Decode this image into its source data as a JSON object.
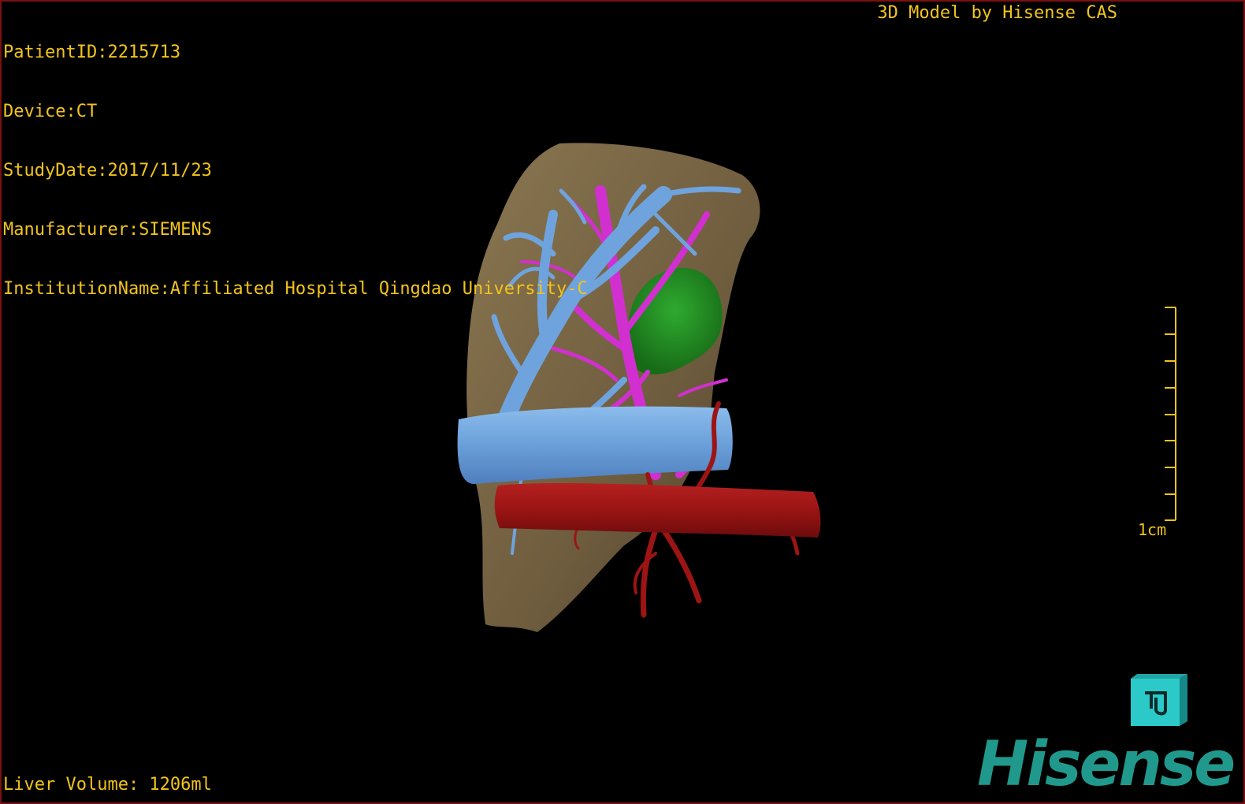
{
  "header": {
    "patient_id": "PatientID:2215713",
    "device": "Device:CT",
    "study_date": "StudyDate:2017/11/23",
    "manufacturer": "Manufacturer:SIEMENS",
    "institution": "InstitutionName:Affiliated Hospital Qingdao University-C",
    "credit": "3D Model by Hisense CAS"
  },
  "footer": {
    "liver_volume": "Liver Volume: 1206ml"
  },
  "scale_bar": {
    "label": "1cm"
  },
  "brand": {
    "name": "Hisense"
  },
  "icons": {
    "orientation_cube": "orientation-cube-icon"
  },
  "colors": {
    "overlay_text": "#f2c41c",
    "liver": "#7a6645",
    "portal_vein": "#6fa3de",
    "hepatic_vein": "#d22fd0",
    "artery": "#9c1414",
    "lesion": "#1f8a1f",
    "brand": "#20998c",
    "cube": "#2cc9c9"
  }
}
